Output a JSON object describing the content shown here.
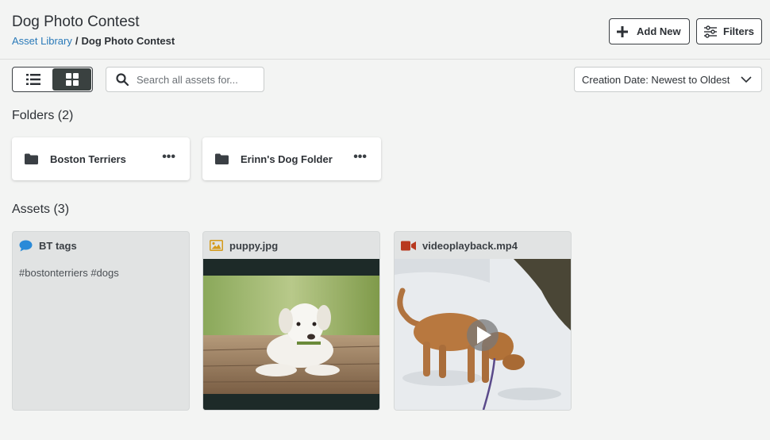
{
  "header": {
    "title": "Dog Photo Contest",
    "breadcrumb": {
      "root": "Asset Library",
      "separator": "/",
      "current": "Dog Photo Contest"
    },
    "add_label": "Add New",
    "filters_label": "Filters"
  },
  "toolbar": {
    "search_placeholder": "Search all assets for...",
    "sort_label": "Creation Date: Newest to Oldest"
  },
  "folders": {
    "title": "Folders (2)",
    "items": [
      {
        "name": "Boston Terriers"
      },
      {
        "name": "Erinn's Dog Folder"
      }
    ]
  },
  "assets": {
    "title": "Assets (3)",
    "items": [
      {
        "name": "BT tags",
        "type": "note",
        "icon": "speech-bubble-icon",
        "body": "#bostonterriers #dogs"
      },
      {
        "name": "puppy.jpg",
        "type": "image",
        "icon": "image-icon"
      },
      {
        "name": "videoplayback.mp4",
        "type": "video",
        "icon": "video-camera-icon"
      }
    ]
  },
  "colors": {
    "link": "#2a7ab9",
    "note_icon": "#2a8ad8",
    "image_icon": "#d49a1a",
    "video_icon": "#b8391f",
    "toggle_active": "#3a4140"
  }
}
